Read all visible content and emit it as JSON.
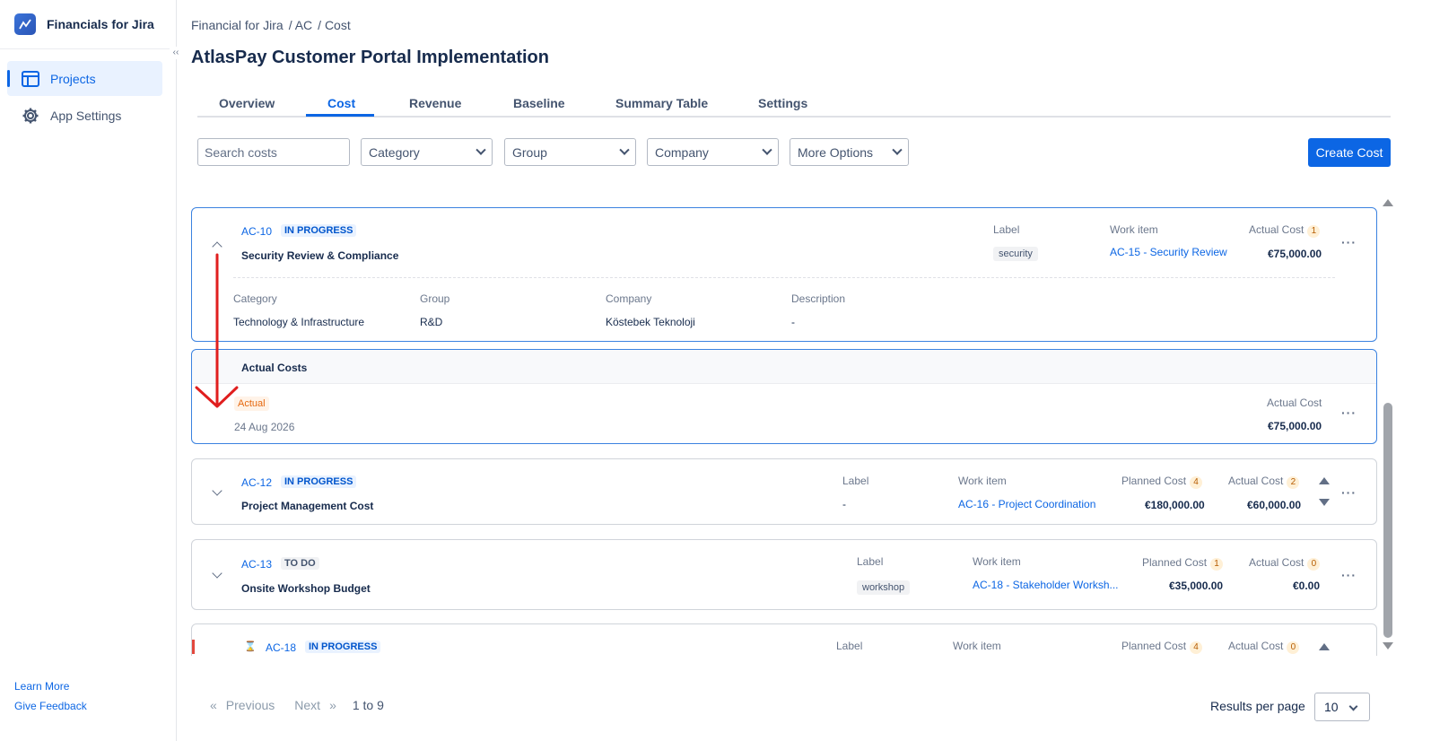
{
  "app": {
    "name": "Financials for Jira"
  },
  "sidebar": {
    "items": [
      {
        "label": "Projects",
        "icon": "board-icon",
        "active": true
      },
      {
        "label": "App Settings",
        "icon": "gear-icon",
        "active": false
      }
    ],
    "footer": {
      "learn_more": "Learn More",
      "give_feedback": "Give Feedback"
    }
  },
  "breadcrumb": [
    "Financial for Jira",
    "/ AC",
    "/ Cost"
  ],
  "page_title": "AtlasPay Customer Portal Implementation",
  "tabs": [
    "Overview",
    "Cost",
    "Revenue",
    "Baseline",
    "Summary Table",
    "Settings"
  ],
  "active_tab": "Cost",
  "filters": {
    "search_placeholder": "Search costs",
    "category": "Category",
    "group": "Group",
    "company": "Company",
    "more_options": "More Options",
    "create_button": "Create Cost"
  },
  "cards": [
    {
      "key": "AC-10",
      "status": "IN PROGRESS",
      "summary": "Security Review & Compliance",
      "label_header": "Label",
      "label_value": "security",
      "work_item_header": "Work item",
      "work_item": "AC-15 - Security Review",
      "actual_header": "Actual Cost",
      "actual_count": "1",
      "actual_value": "€75,000.00",
      "details": {
        "category_header": "Category",
        "category": "Technology & Infrastructure",
        "group_header": "Group",
        "group": "R&D",
        "company_header": "Company",
        "company": "Köstebek Teknoloji",
        "description_header": "Description",
        "description": "-"
      }
    },
    {
      "key": "AC-12",
      "status": "IN PROGRESS",
      "summary": "Project Management Cost",
      "label_header": "Label",
      "label_value": "-",
      "work_item_header": "Work item",
      "work_item": "AC-16 - Project Coordination",
      "planned_header": "Planned Cost",
      "planned_count": "4",
      "planned_value": "€180,000.00",
      "actual_header": "Actual Cost",
      "actual_count": "2",
      "actual_value": "€60,000.00"
    },
    {
      "key": "AC-13",
      "status": "TO DO",
      "summary": "Onsite Workshop Budget",
      "label_header": "Label",
      "label_value": "workshop",
      "work_item_header": "Work item",
      "work_item": "AC-18 - Stakeholder Worksh...",
      "planned_header": "Planned Cost",
      "planned_count": "1",
      "planned_value": "€35,000.00",
      "actual_header": "Actual Cost",
      "actual_count": "0",
      "actual_value": "€0.00"
    },
    {
      "key": "AC-18",
      "status": "IN PROGRESS",
      "label_header": "Label",
      "work_item_header": "Work item",
      "planned_header": "Planned Cost",
      "planned_count": "4",
      "actual_header": "Actual Cost",
      "actual_count": "0"
    }
  ],
  "actual_costs_panel": {
    "title": "Actual Costs",
    "type": "Actual",
    "date": "24 Aug 2026",
    "value_header": "Actual Cost",
    "value": "€75,000.00"
  },
  "pagination": {
    "previous": "Previous",
    "next": "Next",
    "range": "1 to 9",
    "results_per_page_label": "Results per page",
    "results_per_page": "10"
  },
  "colors": {
    "accent": "#0c66e4",
    "annotation_arrow": "#e01e1e"
  }
}
